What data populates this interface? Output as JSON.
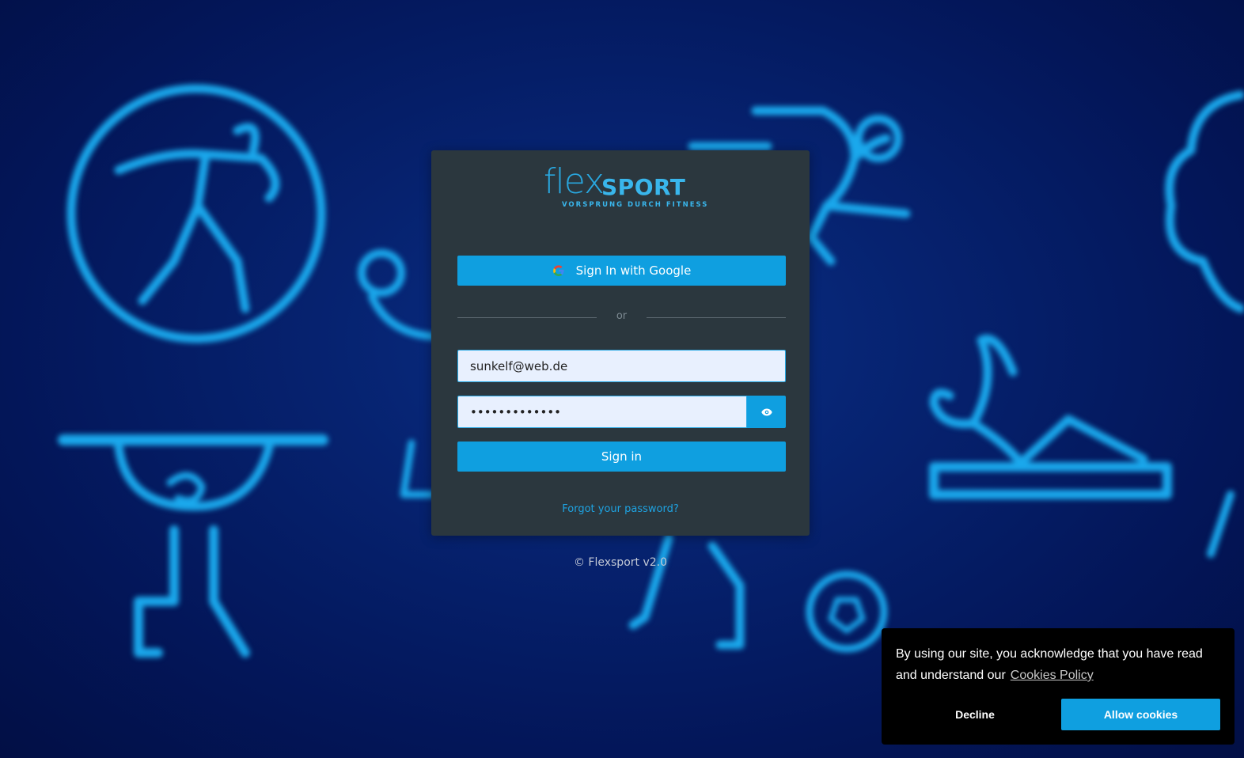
{
  "brand": {
    "logo_flex": "flex",
    "logo_sport": "SPORT",
    "tagline": "VORSPRUNG DURCH FITNESS"
  },
  "login": {
    "google_button": "Sign In with Google",
    "divider_text": "or",
    "email_value": "sunkelf@web.de",
    "password_value": "•••••••••••••",
    "signin_button": "Sign in",
    "forgot_link": "Forgot your password?"
  },
  "footer": {
    "copyright": "© Flexsport v2.0"
  },
  "cookie_banner": {
    "message": "By using our site, you acknowledge that you have read and understand our",
    "policy_link": "Cookies Policy",
    "decline_button": "Decline",
    "allow_button": "Allow cookies"
  },
  "icons": {
    "google": "google-icon",
    "eye": "eye-icon"
  },
  "colors": {
    "accent": "#0f9fe0",
    "card_bg": "#2b373e",
    "page_bg": "#06226f",
    "cookie_bg": "#000000"
  }
}
